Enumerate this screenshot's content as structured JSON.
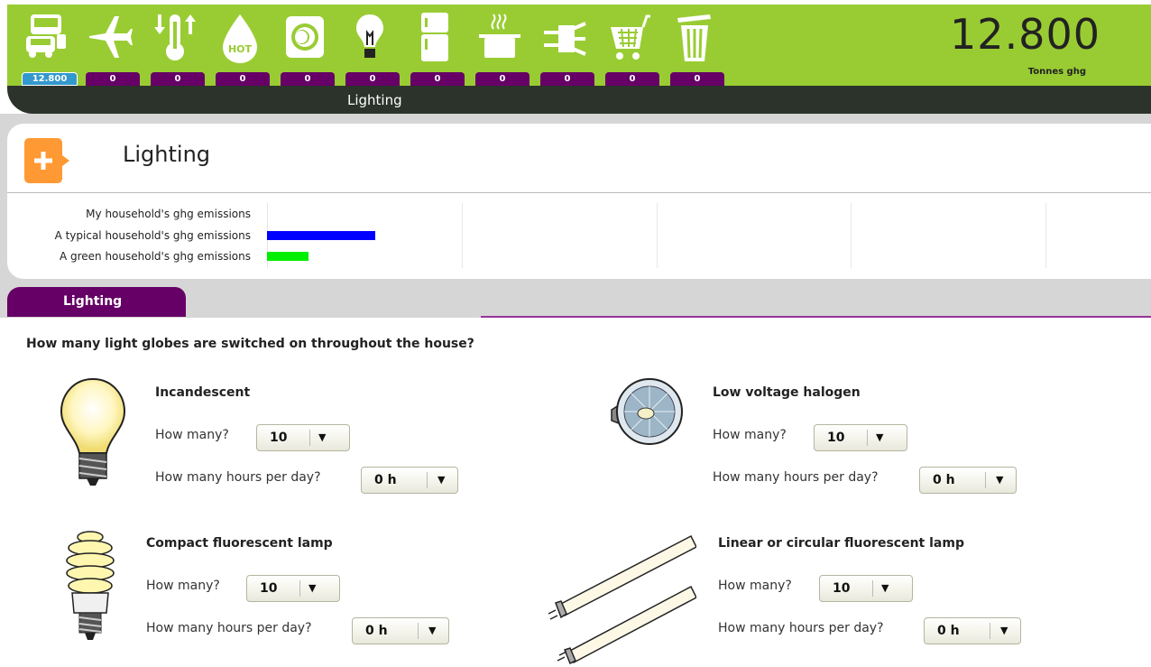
{
  "header": {
    "total_value": "12.800",
    "total_unit": "Tonnes ghg",
    "categories": [
      {
        "icon": "transport-icon",
        "value": "12.800",
        "active": true
      },
      {
        "icon": "plane-icon",
        "value": "0"
      },
      {
        "icon": "thermometer-icon",
        "value": "0"
      },
      {
        "icon": "hot-water-icon",
        "value": "0"
      },
      {
        "icon": "washing-machine-icon",
        "value": "0"
      },
      {
        "icon": "light-bulb-icon",
        "value": "0"
      },
      {
        "icon": "fridge-icon",
        "value": "0"
      },
      {
        "icon": "cooking-pot-icon",
        "value": "0"
      },
      {
        "icon": "power-plug-icon",
        "value": "0"
      },
      {
        "icon": "shopping-cart-icon",
        "value": "0"
      },
      {
        "icon": "rubbish-bin-icon",
        "value": "0"
      }
    ],
    "strip_title": "Lighting"
  },
  "panel": {
    "title": "Lighting",
    "comparison": {
      "labels": [
        "My household's ghg emissions",
        "A typical household's ghg emissions",
        "A green household's ghg emissions"
      ],
      "bar_values": [
        0,
        1.0,
        0.38
      ],
      "bar_colors": [
        "#0000ff",
        "#0000ff",
        "#00ee00"
      ]
    }
  },
  "tab": {
    "label": "Lighting"
  },
  "question": "How many light globes are switched on throughout the house?",
  "lamps": [
    {
      "name": "Incandescent",
      "count_label": "How many?",
      "count": "10",
      "hours_label": "How many hours per day?",
      "hours": "0 h"
    },
    {
      "name": "Low voltage halogen",
      "count_label": "How many?",
      "count": "10",
      "hours_label": "How many hours per day?",
      "hours": "0 h"
    },
    {
      "name": "Compact fluorescent lamp",
      "count_label": "How many?",
      "count": "10",
      "hours_label": "How many hours per day?",
      "hours": "0 h"
    },
    {
      "name": "Linear or circular fluorescent lamp",
      "count_label": "How many?",
      "count": "10",
      "hours_label": "How many hours per day?",
      "hours": "0 h"
    }
  ],
  "colors": {
    "green": "#99cc33",
    "purple": "#660066",
    "active_tab": "#3399cc",
    "orange": "#ff9933"
  }
}
